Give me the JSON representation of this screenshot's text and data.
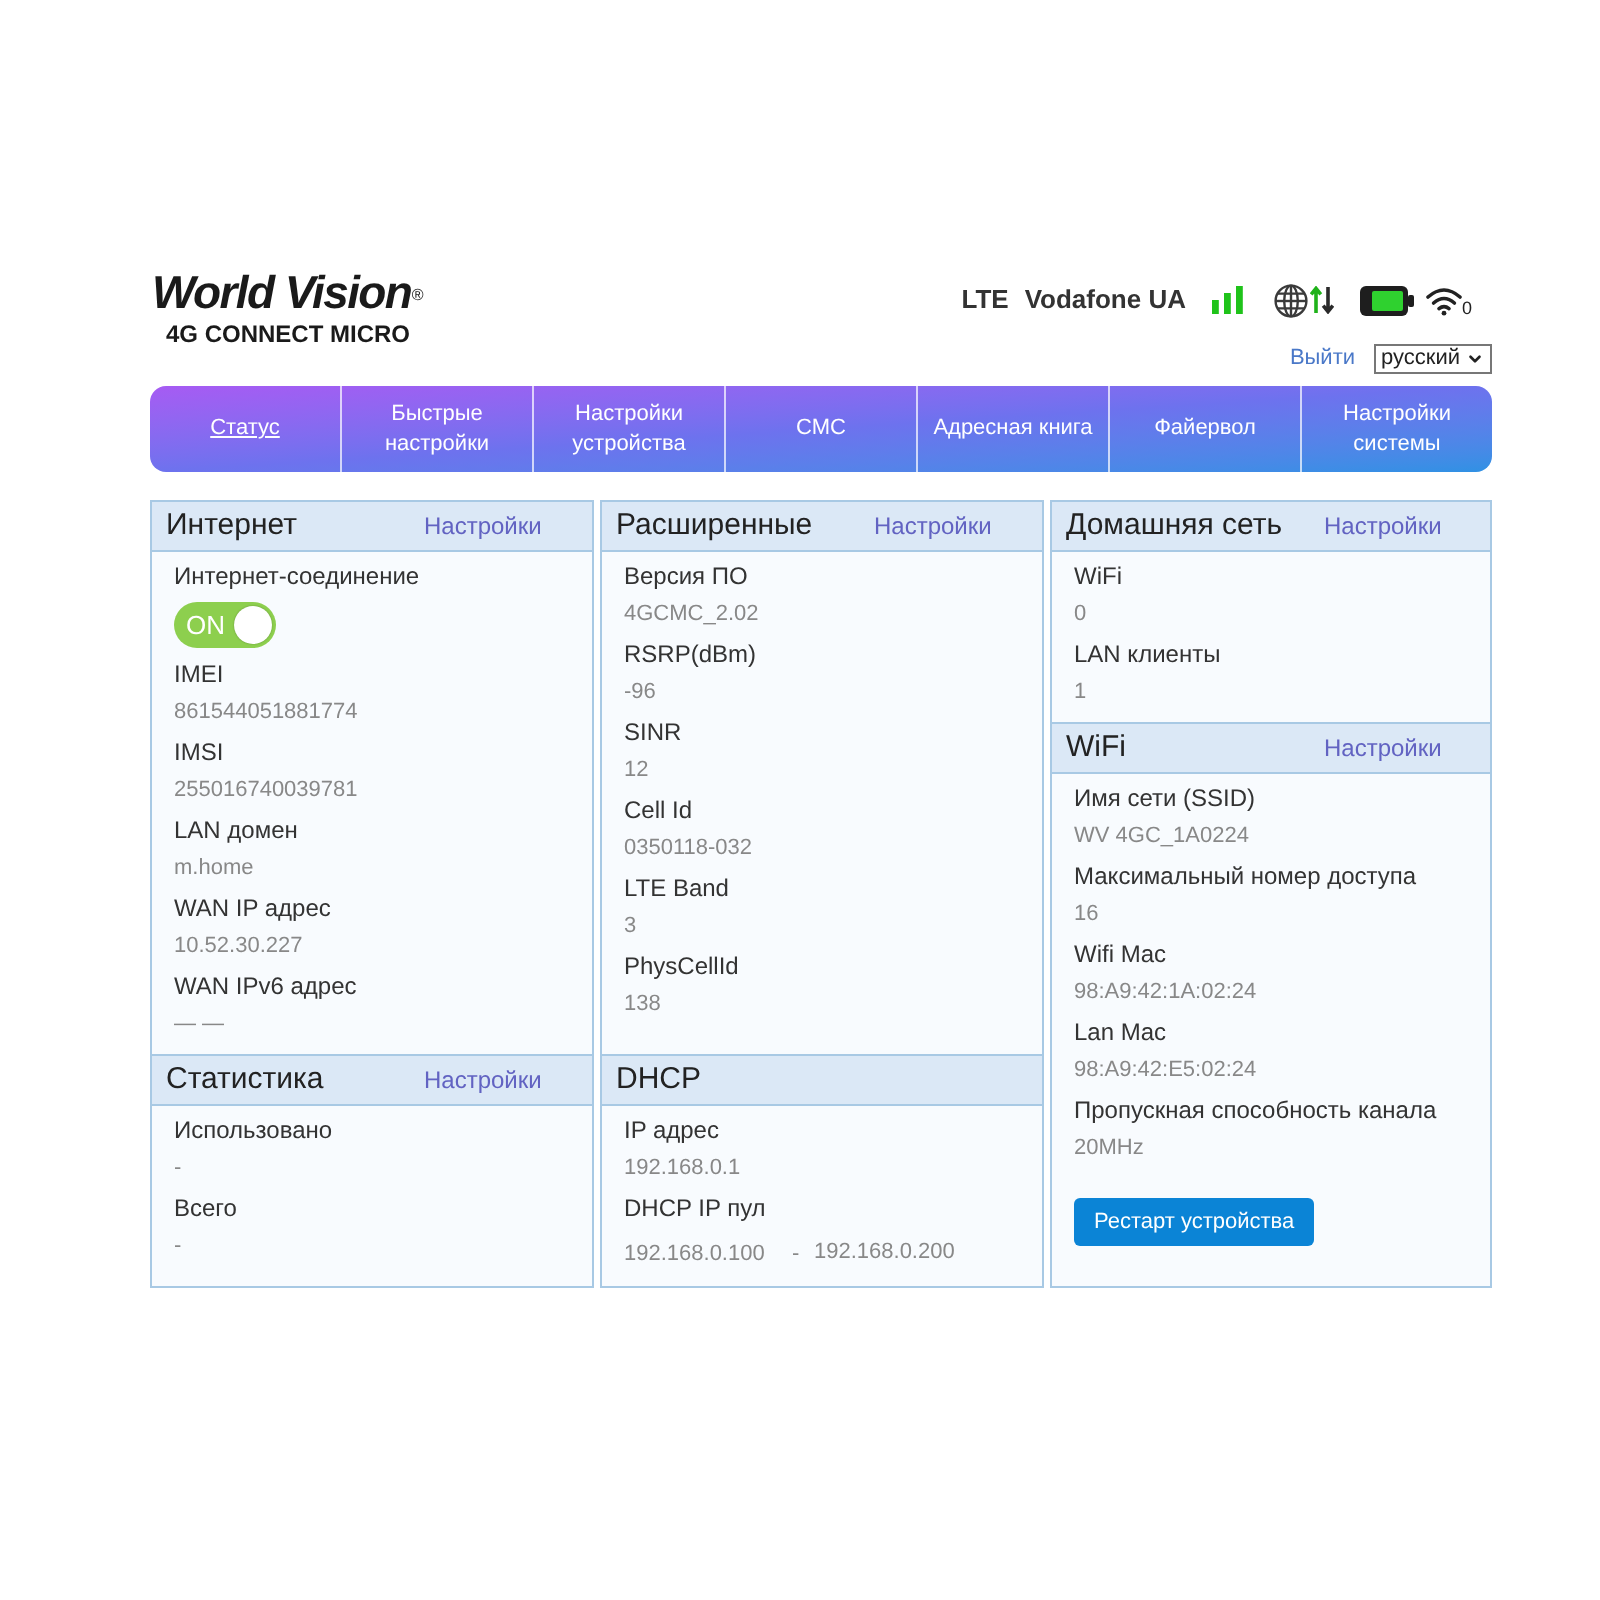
{
  "logo": {
    "brand": "World Vision$^{®}$",
    "product": "4G CONNECT MICRO"
  },
  "status": {
    "network_type": "LTE",
    "operator": "Vodafone UA",
    "wifi_clients": "0"
  },
  "account": {
    "logout": "Выйти",
    "language": "русский"
  },
  "nav": [
    {
      "label": "Статус",
      "selected": true
    },
    {
      "label": "Быстрые настройки",
      "selected": false
    },
    {
      "label": "Настройки устройства",
      "selected": false
    },
    {
      "label": "СМС",
      "selected": false
    },
    {
      "label": "Адресная книга",
      "selected": false
    },
    {
      "label": "Файервол",
      "selected": false
    },
    {
      "label": "Настройки системы",
      "selected": false
    }
  ],
  "columns": [
    {
      "panels": [
        {
          "title": "Интернет",
          "settings_link": "Настройки",
          "fields": [
            {
              "kind": "toggle",
              "label": "Интернет-соединение",
              "on": true,
              "text": "ON"
            },
            {
              "kind": "pair",
              "label": "IMEI",
              "value": "861544051881774"
            },
            {
              "kind": "pair",
              "label": "IMSI",
              "value": "255016740039781"
            },
            {
              "kind": "pair",
              "label": "LAN домен",
              "value": "m.home"
            },
            {
              "kind": "pair",
              "label": "WAN IP адрес",
              "value": "10.52.30.227"
            },
            {
              "kind": "pair",
              "label": "WAN IPv6 адрес",
              "value": "— —"
            }
          ]
        },
        {
          "title": "Статистика",
          "settings_link": "Настройки",
          "fields": [
            {
              "kind": "pair",
              "label": "Использовано",
              "value": "-"
            },
            {
              "kind": "pair",
              "label": "Всего",
              "value": "-"
            }
          ]
        }
      ]
    },
    {
      "panels": [
        {
          "title": "Расширенные",
          "settings_link": "Настройки",
          "fields": [
            {
              "kind": "pair",
              "label": "Версия ПО",
              "value": "4GCMC_2.02"
            },
            {
              "kind": "pair",
              "label": "RSRP(dBm)",
              "value": "-96"
            },
            {
              "kind": "pair",
              "label": "SINR",
              "value": "12"
            },
            {
              "kind": "pair",
              "label": "Cell Id",
              "value": "0350118-032"
            },
            {
              "kind": "pair",
              "label": "LTE Band",
              "value": "3"
            },
            {
              "kind": "pair",
              "label": "PhysCellId",
              "value": "138"
            }
          ]
        },
        {
          "title": "DHCP",
          "fields": [
            {
              "kind": "pair",
              "label": "IP адрес",
              "value": "192.168.0.1"
            },
            {
              "kind": "range",
              "label": "DHCP IP пул",
              "from": "192.168.0.100",
              "separator": "-",
              "to": "192.168.0.200"
            }
          ]
        }
      ]
    },
    {
      "panels": [
        {
          "title": "Домашняя сеть",
          "settings_link": "Настройки",
          "fields": [
            {
              "kind": "pair",
              "label": "WiFi",
              "value": "0"
            },
            {
              "kind": "pair",
              "label": "LAN клиенты",
              "value": "1"
            }
          ]
        },
        {
          "title": "WiFi",
          "settings_link": "Настройки",
          "fields": [
            {
              "kind": "pair",
              "label": "Имя сети (SSID)",
              "value": "WV 4GC_1A0224"
            },
            {
              "kind": "pair",
              "label": "Максимальный номер доступа",
              "value": "16"
            },
            {
              "kind": "pair",
              "label": "Wifi Mac",
              "value": "98:A9:42:1A:02:24"
            },
            {
              "kind": "pair",
              "label": "Lan Mac",
              "value": "98:A9:42:E5:02:24"
            },
            {
              "kind": "pair",
              "label": "Пропускная способность канала",
              "value": "20MHz"
            }
          ],
          "button": "Рестарт устройства"
        }
      ]
    }
  ]
}
